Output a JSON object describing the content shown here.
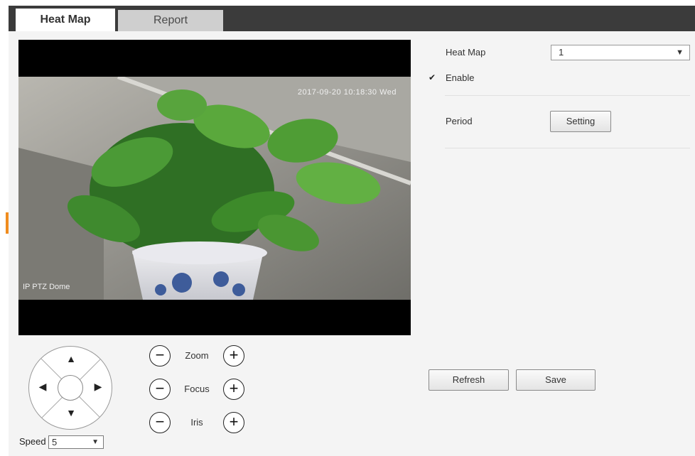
{
  "tabs": [
    {
      "label": "Heat Map",
      "active": true
    },
    {
      "label": "Report",
      "active": false
    }
  ],
  "video": {
    "timestamp": "2017-09-20 10:18:30 Wed",
    "channel_name": "IP PTZ Dome"
  },
  "ptz": {
    "speed_label": "Speed",
    "speed_value": "5",
    "zoom_label": "Zoom",
    "focus_label": "Focus",
    "iris_label": "Iris",
    "minus_symbol": "−",
    "plus_symbol": "+"
  },
  "settings": {
    "heat_map_label": "Heat Map",
    "heat_map_value": "1",
    "enable_label": "Enable",
    "enable_checked": true,
    "period_label": "Period",
    "setting_button": "Setting"
  },
  "actions": {
    "refresh_button": "Refresh",
    "save_button": "Save"
  },
  "icons": {
    "up": "▲",
    "down": "▼",
    "left": "◀",
    "right": "▶",
    "caret": "▼",
    "check": "✔"
  },
  "colors": {
    "accent": "#f08c1e",
    "top_bar": "#3b3b3b",
    "panel_bg": "#f4f4f4"
  }
}
